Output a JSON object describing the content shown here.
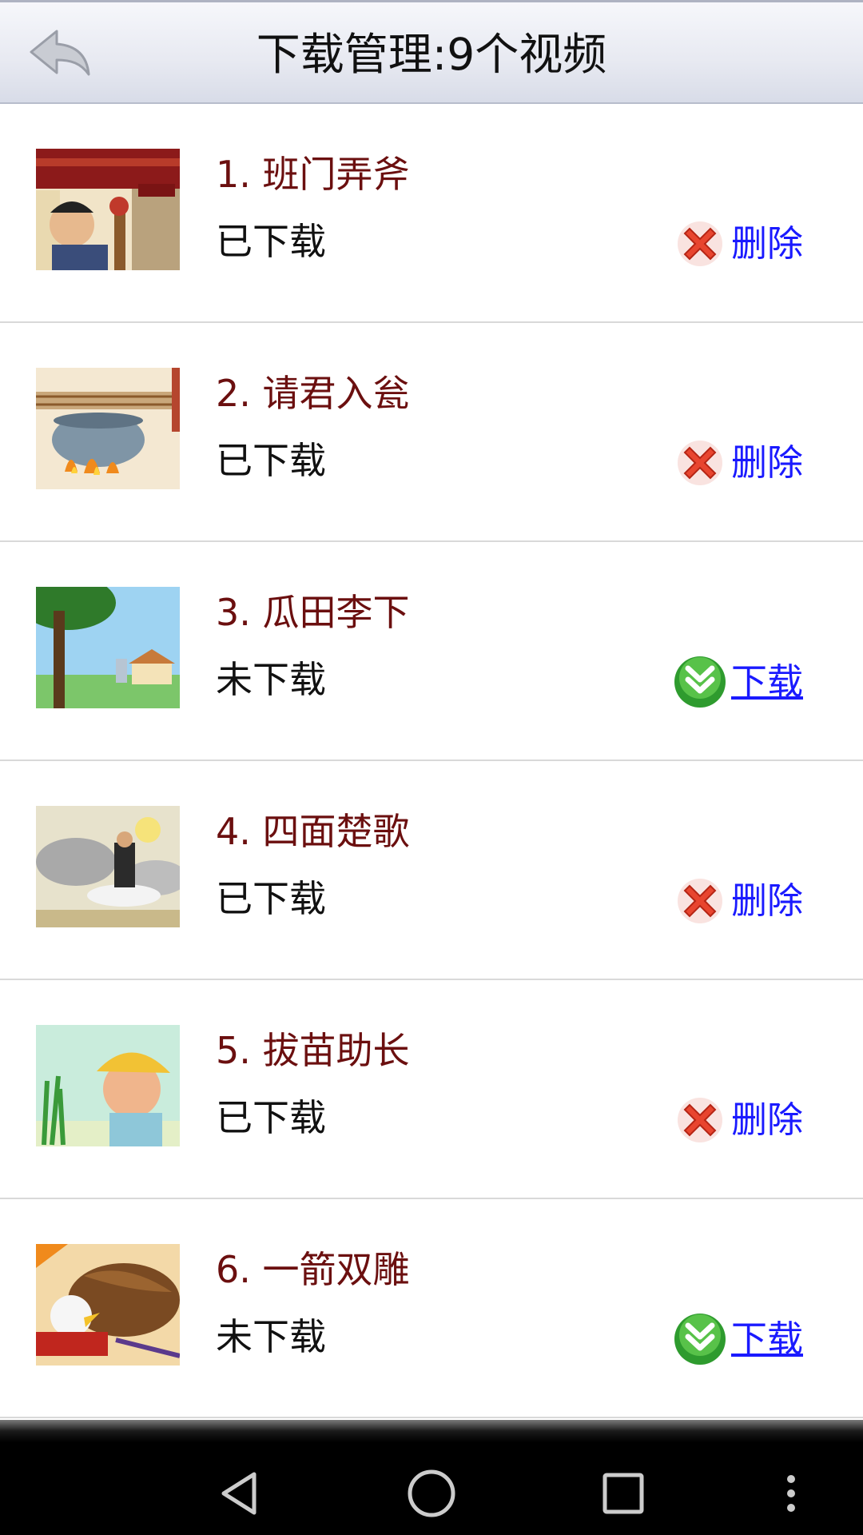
{
  "header": {
    "title": "下载管理:9个视频",
    "back_icon": "back-arrow-icon"
  },
  "colors": {
    "title_text": "#6b0f0f",
    "link_text": "#1a1aff",
    "status_text": "#111111"
  },
  "items": [
    {
      "title": "1. 班门弄斧",
      "status": "已下载",
      "action": "删除",
      "action_icon": "delete-x-icon"
    },
    {
      "title": "2. 请君入瓮",
      "status": "已下载",
      "action": "删除",
      "action_icon": "delete-x-icon"
    },
    {
      "title": "3. 瓜田李下",
      "status": "未下载",
      "action": "下载",
      "action_icon": "download-arrow-icon"
    },
    {
      "title": "4. 四面楚歌",
      "status": "已下载",
      "action": "删除",
      "action_icon": "delete-x-icon"
    },
    {
      "title": "5. 拔苗助长",
      "status": "已下载",
      "action": "删除",
      "action_icon": "delete-x-icon"
    },
    {
      "title": "6. 一箭双雕",
      "status": "未下载",
      "action": "下载",
      "action_icon": "download-arrow-icon"
    }
  ],
  "navbar": {
    "back_icon": "triangle-back-icon",
    "home_icon": "circle-home-icon",
    "recents_icon": "square-recents-icon",
    "menu_icon": "vertical-dots-menu-icon"
  }
}
